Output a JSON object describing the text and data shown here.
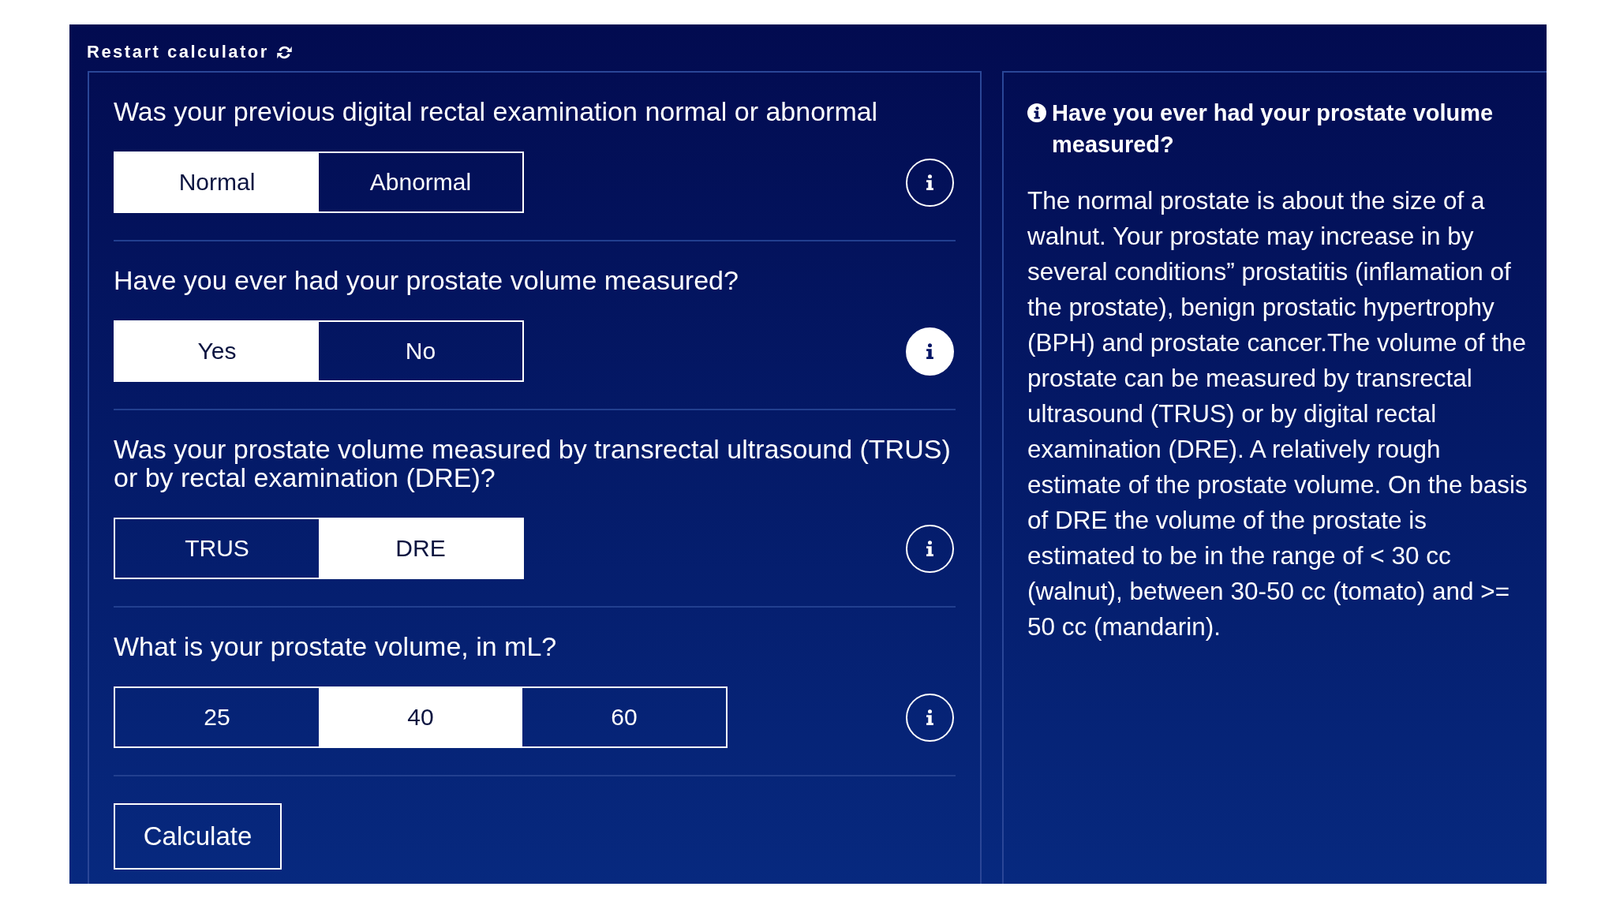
{
  "restart": {
    "label": "Restart calculator"
  },
  "questions": [
    {
      "text": "Was your previous digital rectal examination normal or abnormal",
      "options": [
        {
          "label": "Normal",
          "selected": true
        },
        {
          "label": "Abnormal",
          "selected": false
        }
      ],
      "info_button": {
        "selected": false
      }
    },
    {
      "text": "Have you ever had your prostate volume measured?",
      "options": [
        {
          "label": "Yes",
          "selected": true
        },
        {
          "label": "No",
          "selected": false
        }
      ],
      "info_button": {
        "selected": true
      }
    },
    {
      "text": "Was your prostate volume measured by transrectal ultrasound (TRUS) or by rectal examination (DRE)?",
      "options": [
        {
          "label": "TRUS",
          "selected": false
        },
        {
          "label": "DRE",
          "selected": true
        }
      ],
      "info_button": {
        "selected": false
      }
    },
    {
      "text": "What is your prostate volume, in mL?",
      "options": [
        {
          "label": "25",
          "selected": false
        },
        {
          "label": "40",
          "selected": true
        },
        {
          "label": "60",
          "selected": false
        }
      ],
      "info_button": {
        "selected": false
      }
    }
  ],
  "calculate_button": {
    "label": "Calculate"
  },
  "info_panel": {
    "title": "Have you ever had your prostate volume measured?",
    "body": "The normal prostate is about the size of a walnut. Your prostate may increase in by several conditions” prostatitis (inflamation of the prostate), benign prostatic hypertrophy (BPH) and prostate cancer.The volume of the prostate can be measured by transrectal ultrasound (TRUS) or by digital rectal examination (DRE). A relatively rough estimate of the prostate volume. On the basis of DRE the volume of the prostate is estimated to be in the range of < 30 cc (walnut), between 30-50 cc (tomato) and >= 50 cc (mandarin)."
  }
}
